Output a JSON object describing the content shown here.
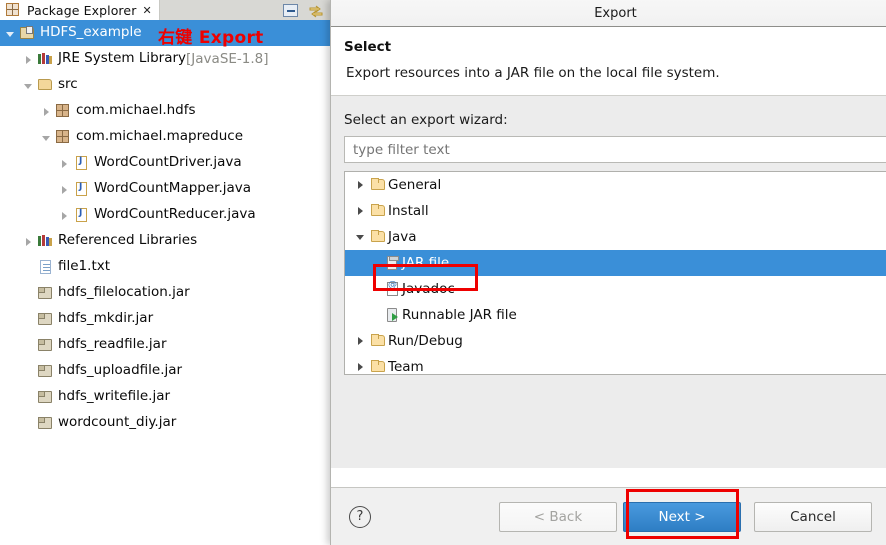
{
  "explorer": {
    "tab_label": "Package Explorer",
    "tab_close_glyph": "✕",
    "toolbar": [
      {
        "name": "minimize-icon",
        "label": "Minimize"
      },
      {
        "name": "link-with-editor-icon",
        "label": "Link with Editor"
      }
    ],
    "annotation": "右键 Export",
    "tree": [
      {
        "label": "HDFS_example",
        "suffix": "",
        "indent": 0,
        "icon": "project-icon",
        "state": "open",
        "selected": true
      },
      {
        "label": "JRE System Library",
        "suffix": " [JavaSE-1.8]",
        "indent": 1,
        "icon": "library-icon",
        "state": "closed",
        "selected": false
      },
      {
        "label": "src",
        "suffix": "",
        "indent": 1,
        "icon": "source-folder-icon",
        "state": "open",
        "selected": false
      },
      {
        "label": "com.michael.hdfs",
        "suffix": "",
        "indent": 2,
        "icon": "package-icon",
        "state": "closed",
        "selected": false
      },
      {
        "label": "com.michael.mapreduce",
        "suffix": "",
        "indent": 2,
        "icon": "package-icon",
        "state": "open",
        "selected": false
      },
      {
        "label": "WordCountDriver.java",
        "suffix": "",
        "indent": 3,
        "icon": "java-file-icon",
        "state": "closed",
        "selected": false
      },
      {
        "label": "WordCountMapper.java",
        "suffix": "",
        "indent": 3,
        "icon": "java-file-icon",
        "state": "closed",
        "selected": false
      },
      {
        "label": "WordCountReducer.java",
        "suffix": "",
        "indent": 3,
        "icon": "java-file-icon",
        "state": "closed",
        "selected": false
      },
      {
        "label": "Referenced Libraries",
        "suffix": "",
        "indent": 1,
        "icon": "library-icon",
        "state": "closed",
        "selected": false
      },
      {
        "label": "file1.txt",
        "suffix": "",
        "indent": 1,
        "icon": "text-file-icon",
        "state": "none",
        "selected": false
      },
      {
        "label": "hdfs_filelocation.jar",
        "suffix": "",
        "indent": 1,
        "icon": "jar-icon",
        "state": "none",
        "selected": false
      },
      {
        "label": "hdfs_mkdir.jar",
        "suffix": "",
        "indent": 1,
        "icon": "jar-icon",
        "state": "none",
        "selected": false
      },
      {
        "label": "hdfs_readfile.jar",
        "suffix": "",
        "indent": 1,
        "icon": "jar-icon",
        "state": "none",
        "selected": false
      },
      {
        "label": "hdfs_uploadfile.jar",
        "suffix": "",
        "indent": 1,
        "icon": "jar-icon",
        "state": "none",
        "selected": false
      },
      {
        "label": "hdfs_writefile.jar",
        "suffix": "",
        "indent": 1,
        "icon": "jar-icon",
        "state": "none",
        "selected": false
      },
      {
        "label": "wordcount_diy.jar",
        "suffix": "",
        "indent": 1,
        "icon": "jar-icon",
        "state": "none",
        "selected": false
      }
    ]
  },
  "dialog": {
    "title": "Export",
    "heading": "Select",
    "description": "Export resources into a JAR file on the local file system.",
    "wizard_label": "Select an export wizard:",
    "filter_placeholder": "type filter text",
    "filter_value": "",
    "wizard_tree": [
      {
        "label": "General",
        "icon": "folder-icon",
        "state": "closed",
        "level": 0,
        "selected": false
      },
      {
        "label": "Install",
        "icon": "folder-icon",
        "state": "closed",
        "level": 0,
        "selected": false
      },
      {
        "label": "Java",
        "icon": "folder-icon",
        "state": "open",
        "level": 0,
        "selected": false
      },
      {
        "label": "JAR file",
        "icon": "jar-file-icon",
        "state": "none",
        "level": 1,
        "selected": true
      },
      {
        "label": "Javadoc",
        "icon": "javadoc-icon",
        "state": "none",
        "level": 1,
        "selected": false
      },
      {
        "label": "Runnable JAR file",
        "icon": "runnable-jar-icon",
        "state": "none",
        "level": 1,
        "selected": false
      },
      {
        "label": "Run/Debug",
        "icon": "folder-icon",
        "state": "closed",
        "level": 0,
        "selected": false
      },
      {
        "label": "Team",
        "icon": "folder-icon",
        "state": "closed",
        "level": 0,
        "selected": false
      }
    ],
    "footer": {
      "help_glyph": "?",
      "back_label": "< Back",
      "next_label": "Next >",
      "cancel_label": "Cancel"
    }
  },
  "colors": {
    "selection_blue": "#3a8fd8",
    "annotation_red": "#ee0000",
    "primary_button": "#2e7ec4",
    "dialog_body": "#ececec"
  }
}
